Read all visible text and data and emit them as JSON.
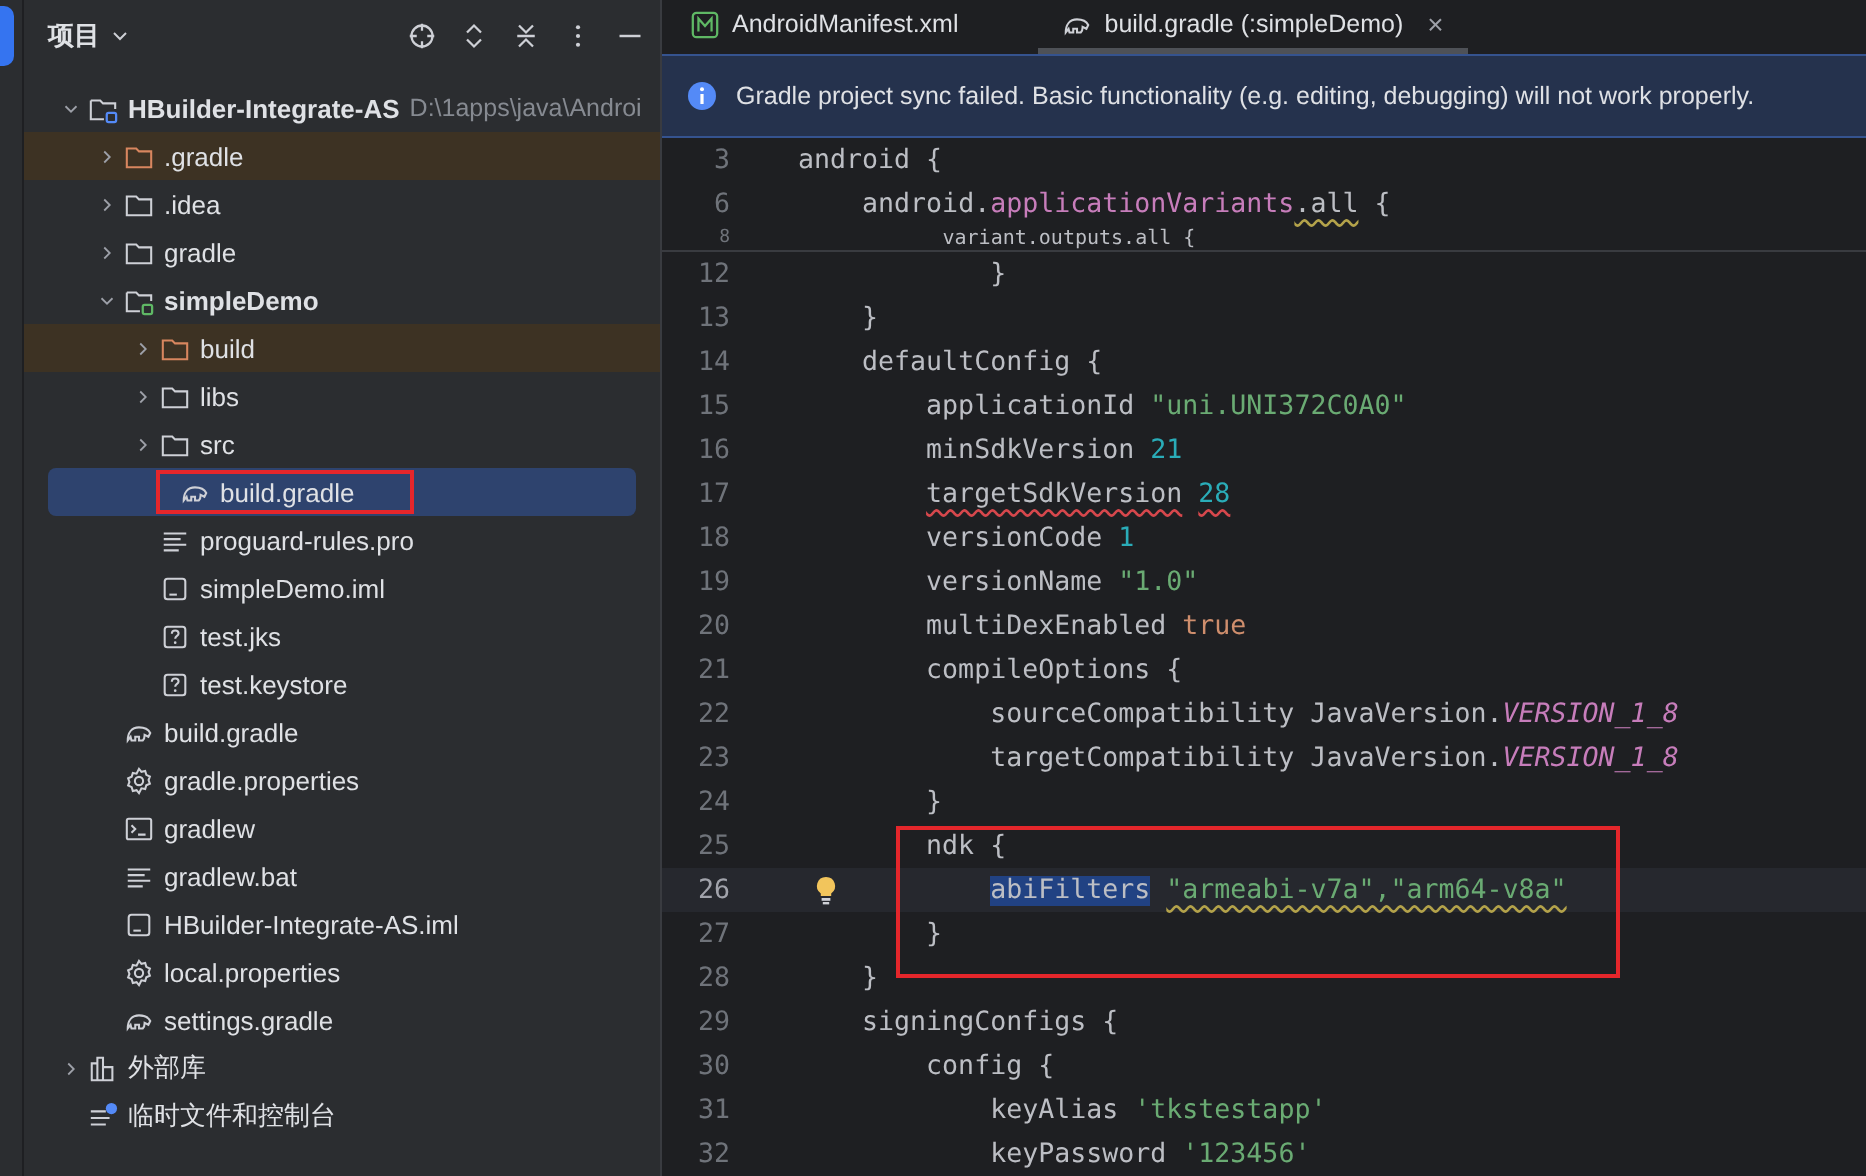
{
  "project_panel": {
    "title": "项目",
    "tree": [
      {
        "label": "HBuilder-Integrate-AS",
        "kind": "project",
        "path": "D:\\1apps\\java\\Androi",
        "expanded": true,
        "selected": false,
        "children": [
          {
            "label": ".gradle",
            "kind": "folder",
            "excluded": true,
            "expanded": false,
            "selected": false
          },
          {
            "label": ".idea",
            "kind": "folder",
            "expanded": false,
            "selected": false
          },
          {
            "label": "gradle",
            "kind": "folder",
            "expanded": false,
            "selected": false
          },
          {
            "label": "simpleDemo",
            "kind": "module",
            "expanded": true,
            "selected": false,
            "children": [
              {
                "label": "build",
                "kind": "folder",
                "excluded": true,
                "expanded": false,
                "selected": false
              },
              {
                "label": "libs",
                "kind": "folder",
                "expanded": false,
                "selected": false
              },
              {
                "label": "src",
                "kind": "folder",
                "expanded": false,
                "selected": false
              },
              {
                "label": "build.gradle",
                "kind": "gradle",
                "selected": true,
                "annotated": true
              },
              {
                "label": "proguard-rules.pro",
                "kind": "text",
                "selected": false
              },
              {
                "label": "simpleDemo.iml",
                "kind": "iml",
                "selected": false
              },
              {
                "label": "test.jks",
                "kind": "unknown",
                "selected": false
              },
              {
                "label": "test.keystore",
                "kind": "unknown",
                "selected": false
              }
            ]
          },
          {
            "label": "build.gradle",
            "kind": "gradle",
            "selected": false
          },
          {
            "label": "gradle.properties",
            "kind": "settings",
            "selected": false
          },
          {
            "label": "gradlew",
            "kind": "terminal",
            "selected": false
          },
          {
            "label": "gradlew.bat",
            "kind": "text",
            "selected": false
          },
          {
            "label": "HBuilder-Integrate-AS.iml",
            "kind": "iml",
            "selected": false
          },
          {
            "label": "local.properties",
            "kind": "settings",
            "selected": false
          },
          {
            "label": "settings.gradle",
            "kind": "gradle",
            "selected": false
          }
        ]
      },
      {
        "label": "外部库",
        "kind": "library",
        "expanded": false,
        "selected": false
      },
      {
        "label": "临时文件和控制台",
        "kind": "scratch",
        "selected": false
      }
    ]
  },
  "editor": {
    "tabs": [
      {
        "label": "AndroidManifest.xml",
        "kind": "manifest",
        "selected": false
      },
      {
        "label": "build.gradle (:simpleDemo)",
        "kind": "gradle",
        "selected": true,
        "close": "×"
      }
    ],
    "banner": {
      "text": "Gradle project sync failed. Basic functionality (e.g. editing, debugging) will not work properly."
    },
    "sticky_lines": [
      {
        "number": "3",
        "tokens": [
          {
            "text": "android {"
          }
        ]
      },
      {
        "number": "6",
        "tokens": [
          {
            "text": "    android."
          },
          {
            "text": "applicationVariants",
            "kind": "field"
          },
          {
            "text": ".all",
            "warning": true
          },
          {
            "text": " {"
          }
        ]
      },
      {
        "number": "8",
        "cut": true,
        "tokens": [
          {
            "text": "            variant.outputs.all {"
          }
        ]
      }
    ],
    "lines": [
      {
        "number": "12",
        "tokens": [
          {
            "text": "            }"
          }
        ]
      },
      {
        "number": "13",
        "tokens": [
          {
            "text": "    }"
          }
        ]
      },
      {
        "number": "14",
        "tokens": [
          {
            "text": "    defaultConfig {"
          }
        ]
      },
      {
        "number": "15",
        "tokens": [
          {
            "text": "        applicationId "
          },
          {
            "text": "\"uni.UNI372C0A0\"",
            "kind": "string"
          }
        ]
      },
      {
        "number": "16",
        "tokens": [
          {
            "text": "        minSdkVersion "
          },
          {
            "text": "21",
            "kind": "number"
          }
        ]
      },
      {
        "number": "17",
        "tokens": [
          {
            "text": "        targetSdkVersion ",
            "error": true
          },
          {
            "text": "28",
            "kind": "number",
            "error": true
          }
        ]
      },
      {
        "number": "18",
        "tokens": [
          {
            "text": "        versionCode "
          },
          {
            "text": "1",
            "kind": "number"
          }
        ]
      },
      {
        "number": "19",
        "tokens": [
          {
            "text": "        versionName "
          },
          {
            "text": "\"1.0\"",
            "kind": "string"
          }
        ]
      },
      {
        "number": "20",
        "tokens": [
          {
            "text": "        multiDexEnabled "
          },
          {
            "text": "true",
            "kind": "keyword"
          }
        ]
      },
      {
        "number": "21",
        "tokens": [
          {
            "text": "        compileOptions {"
          }
        ]
      },
      {
        "number": "22",
        "tokens": [
          {
            "text": "            sourceCompatibility JavaVersion."
          },
          {
            "text": "VERSION_1_8",
            "kind": "constant"
          }
        ]
      },
      {
        "number": "23",
        "tokens": [
          {
            "text": "            targetCompatibility JavaVersion."
          },
          {
            "text": "VERSION_1_8",
            "kind": "constant"
          }
        ]
      },
      {
        "number": "24",
        "tokens": [
          {
            "text": "        }"
          }
        ]
      },
      {
        "number": "25",
        "boxed": true,
        "tokens": [
          {
            "text": "        ndk {"
          }
        ]
      },
      {
        "number": "26",
        "boxed": true,
        "current": true,
        "bulb": true,
        "tokens": [
          {
            "text": "            abiFilters ",
            "selection": true
          },
          {
            "text": "\"armeabi-v7a\",\"arm64-v8a\"",
            "kind": "string",
            "warning": true
          }
        ]
      },
      {
        "number": "27",
        "boxed": true,
        "tokens": [
          {
            "text": "        }"
          }
        ]
      },
      {
        "number": "28",
        "tokens": [
          {
            "text": "    }"
          }
        ]
      },
      {
        "number": "29",
        "tokens": [
          {
            "text": "    signingConfigs {"
          }
        ]
      },
      {
        "number": "30",
        "tokens": [
          {
            "text": "        config {"
          }
        ]
      },
      {
        "number": "31",
        "tokens": [
          {
            "text": "            keyAlias "
          },
          {
            "text": "'tkstestapp'",
            "kind": "string"
          }
        ]
      },
      {
        "number": "32",
        "tokens": [
          {
            "text": "            keyPassword "
          },
          {
            "text": "'123456'",
            "kind": "string"
          }
        ]
      }
    ]
  }
}
